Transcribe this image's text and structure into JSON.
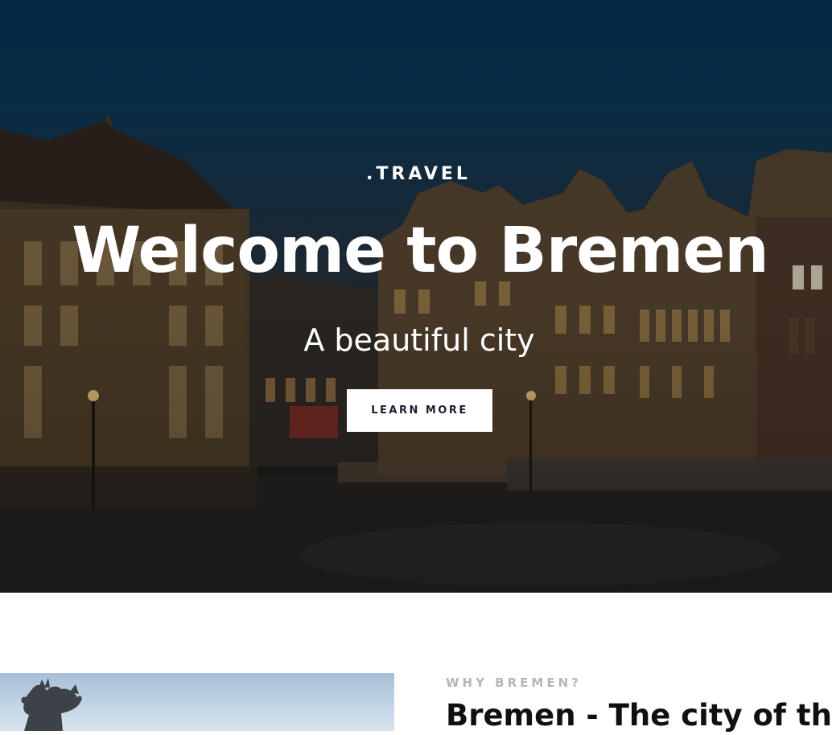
{
  "hero": {
    "eyebrow": ".TRAVEL",
    "title": "Welcome to Bremen",
    "subtitle": "A beautiful city",
    "button_label": "LEARN MORE",
    "background_image": "bremen-market-square-photo"
  },
  "about": {
    "eyebrow": "WHY BREMEN?",
    "title": "Bremen - The city of the",
    "image": "rooster-statue-photo"
  },
  "colors": {
    "sky": "#072a46",
    "button_bg": "#ffffff",
    "button_text": "#1c1f2f",
    "eyebrow_gray": "#b5b5bd",
    "heading_dark": "#0f0f14"
  }
}
